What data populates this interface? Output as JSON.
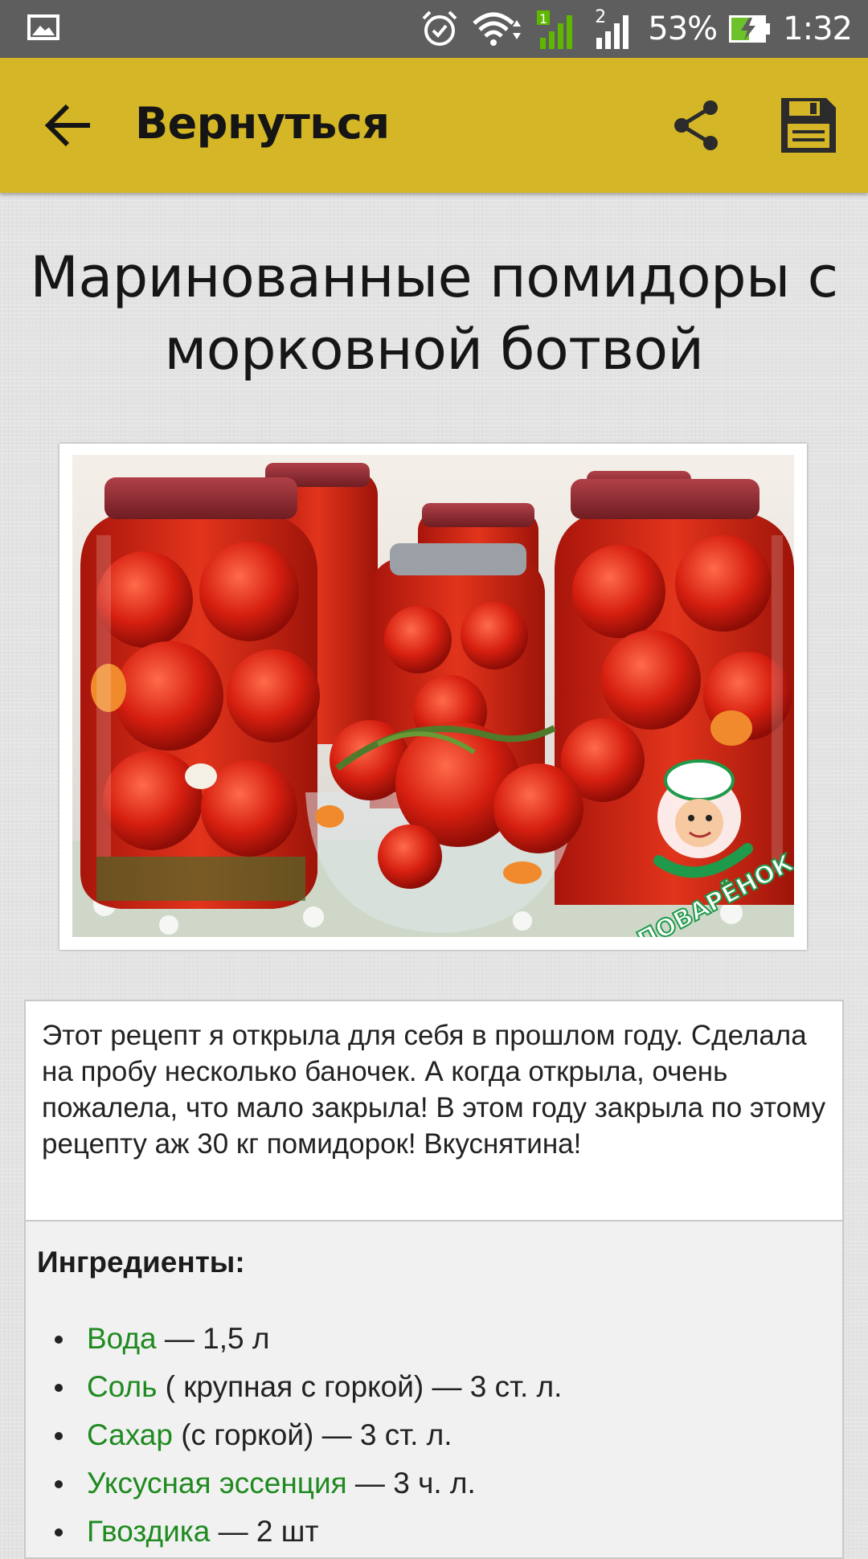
{
  "status_bar": {
    "battery": "53%",
    "time": "1:32",
    "sim2": "2"
  },
  "action_bar": {
    "title": "Вернуться"
  },
  "recipe": {
    "title_line1": "Маринованные помидоры с",
    "title_line2": "морковной ботвой",
    "image_watermark": "ПОВАРЁНОК.РУ",
    "description": "Этот рецепт я открыла для себя в прошлом году. Сделала на пробу несколько баночек. А когда открыла, очень пожалела, что мало закрыла! В этом году закрыла по этому рецепту аж 30 кг помидорок! Вкуснятина!"
  },
  "ingredients": {
    "heading": "Ингредиенты:",
    "items": [
      {
        "name": "Вода",
        "amount": " — 1,5 л"
      },
      {
        "name": "Соль",
        "amount": " ( крупная с горкой) — 3 ст. л."
      },
      {
        "name": "Сахар",
        "amount": " (с горкой) — 3 ст. л."
      },
      {
        "name": "Уксусная эссенция",
        "amount": " — 3 ч. л."
      },
      {
        "name": "Гвоздика",
        "amount": " — 2 шт"
      }
    ]
  },
  "colors": {
    "action_bar": "#d5b626",
    "ingredient_link": "#1f8a1f",
    "status_bar": "#5e5e5e"
  }
}
